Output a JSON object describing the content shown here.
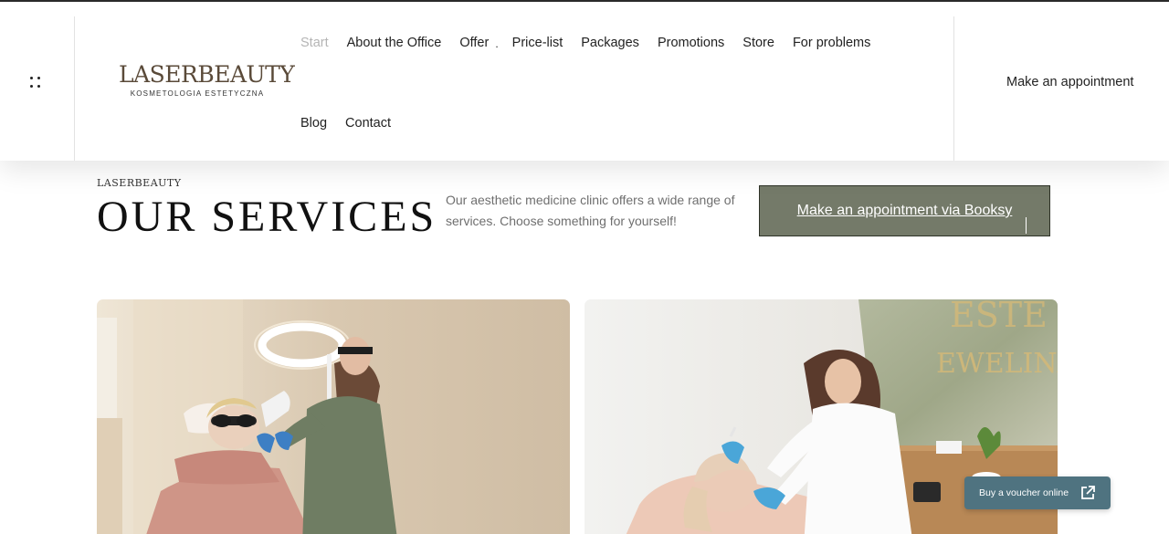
{
  "header": {
    "logo": {
      "name": "LASERBEAUTY",
      "tagline": "KOSMETOLOGIA ESTETYCZNA"
    },
    "nav": {
      "row1": [
        {
          "label": "Start",
          "active": true
        },
        {
          "label": "About the Office"
        },
        {
          "label": "Offer",
          "has_dropdown": true
        },
        {
          "label": "Price-list"
        },
        {
          "label": "Packages"
        },
        {
          "label": "Promotions"
        },
        {
          "label": "Store"
        },
        {
          "label": "For problems"
        }
      ],
      "row2": [
        {
          "label": "Blog"
        },
        {
          "label": "Contact"
        }
      ],
      "dropdown_marker": "."
    },
    "appointment_label": "Make an appointment",
    "menu_icon": "grid-dots-icon"
  },
  "hero": {
    "eyebrow": "LASERBEAUTY",
    "title": "OUR SERVICES",
    "description": "Our aesthetic medicine clinic offers a wide range of services. Choose something for yourself!",
    "cta_label": "Make an appointment via Booksy",
    "cta_color": "#747a69"
  },
  "services": [
    {
      "image": "laser-treatment-photo"
    },
    {
      "image": "facial-injection-photo",
      "wall_text_1": "ESTE",
      "wall_text_2": "EWELINA"
    }
  ],
  "floating": {
    "voucher_label": "Buy a voucher online",
    "voucher_icon": "external-link-icon",
    "voucher_color": "#4f7380"
  }
}
